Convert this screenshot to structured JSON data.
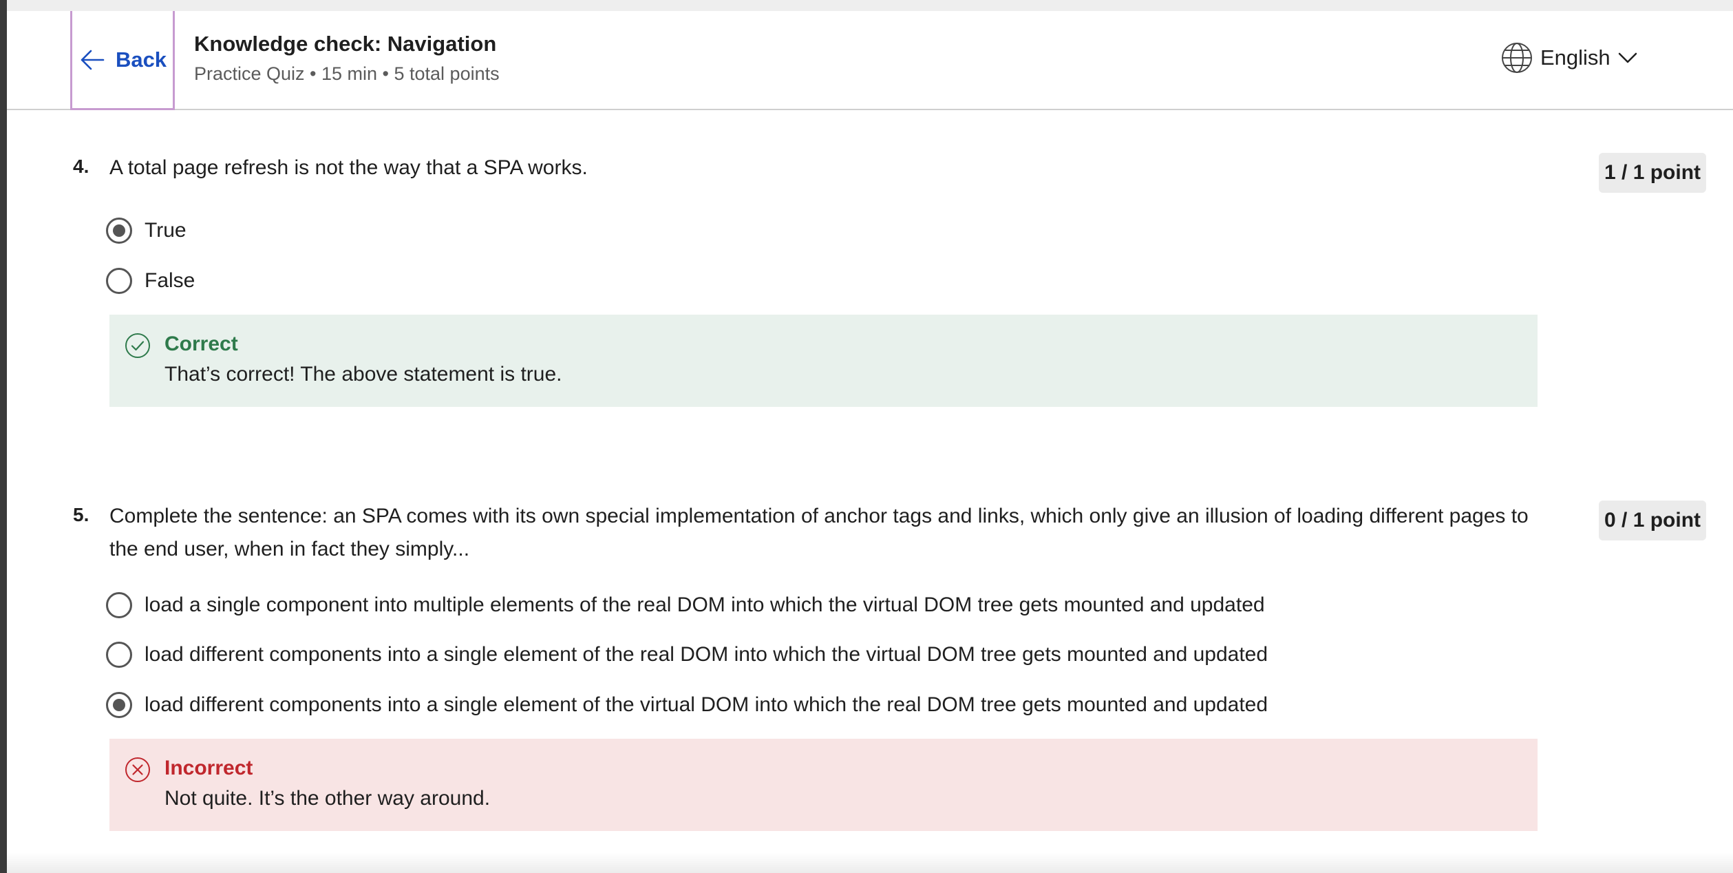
{
  "header": {
    "back_label": "Back",
    "title": "Knowledge check: Navigation",
    "subtitle": "Practice Quiz • 15 min • 5 total points",
    "language": "English"
  },
  "questions": [
    {
      "number": "4.",
      "text": "A total page refresh is not the way that a SPA works.",
      "points": "1 / 1 point",
      "options": [
        {
          "label": "True",
          "selected": true
        },
        {
          "label": "False",
          "selected": false
        }
      ],
      "feedback": {
        "status": "Correct",
        "message": "That’s correct! The above statement is true."
      }
    },
    {
      "number": "5.",
      "text_line1": "Complete the sentence: an SPA comes with its own special implementation of anchor tags and links, which only give an illusion of loading different pages to",
      "text_line2": "the end user, when in fact they simply...",
      "points": "0 / 1 point",
      "options": [
        {
          "label": "load a single component into multiple elements of the real DOM into which the virtual DOM tree gets mounted and updated",
          "selected": false
        },
        {
          "label": "load different components into a single element of the real DOM into which the virtual DOM tree gets mounted and updated",
          "selected": false
        },
        {
          "label": "load different components into a single element of the virtual DOM into which the real DOM tree gets mounted and updated",
          "selected": true
        }
      ],
      "feedback": {
        "status": "Incorrect",
        "message": "Not quite. It’s the other way around."
      }
    }
  ],
  "colors": {
    "link_blue": "#1a4fbf",
    "correct_green": "#2e7a4b",
    "incorrect_red": "#c0272d",
    "correct_bg": "#e8f1ec",
    "incorrect_bg": "#f8e4e4"
  },
  "icons": {
    "back": "arrow-left-icon",
    "language": "globe-icon",
    "language_caret": "chevron-down-icon",
    "correct": "check-circle-icon",
    "incorrect": "x-circle-icon"
  }
}
